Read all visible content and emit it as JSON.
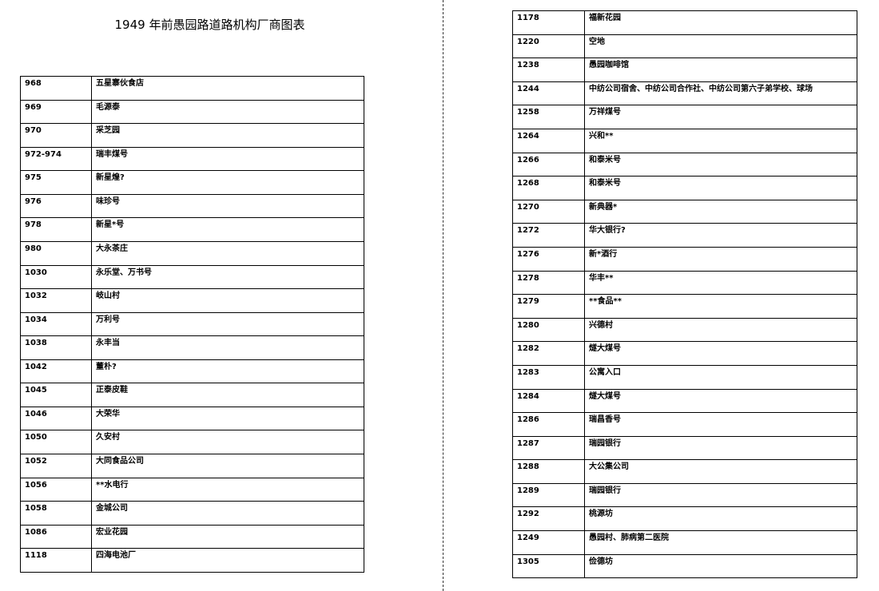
{
  "document": {
    "title": "1949 年前愚园路道路机构厂商图表"
  },
  "left_table": {
    "rows": [
      [
        "968",
        "五星寨伙食店"
      ],
      [
        "969",
        "毛源泰"
      ],
      [
        "970",
        "采芝园"
      ],
      [
        "972-974",
        "瑞丰煤号"
      ],
      [
        "975",
        "新星煌?"
      ],
      [
        "976",
        "味珍号"
      ],
      [
        "978",
        "新星*号"
      ],
      [
        "980",
        "大永茶庄"
      ],
      [
        "1030",
        "永乐堂、万书号"
      ],
      [
        "1032",
        "岐山村"
      ],
      [
        "1034",
        "万利号"
      ],
      [
        "1038",
        "永丰当"
      ],
      [
        "1042",
        "董朴?"
      ],
      [
        "1045",
        "正泰皮鞋"
      ],
      [
        "1046",
        "大荣华"
      ],
      [
        "1050",
        "久安村"
      ],
      [
        "1052",
        "大同食品公司"
      ],
      [
        "1056",
        "**水电行"
      ],
      [
        "1058",
        "金城公司"
      ],
      [
        "1086",
        "宏业花园"
      ],
      [
        "1118",
        "四海电池厂"
      ]
    ]
  },
  "right_table": {
    "rows": [
      [
        "1178",
        "福新花园"
      ],
      [
        "1220",
        "空地"
      ],
      [
        "1238",
        "愚园咖啡馆"
      ],
      [
        "1244",
        "中纺公司宿舍、中纺公司合作社、中纺公司第六子弟学校、球场"
      ],
      [
        "1258",
        "万祥煤号"
      ],
      [
        "1264",
        "兴和**"
      ],
      [
        "1266",
        "和泰米号"
      ],
      [
        "1268",
        "和泰米号"
      ],
      [
        "1270",
        "新典器*"
      ],
      [
        "1272",
        "华大银行?"
      ],
      [
        "1276",
        "新*酒行"
      ],
      [
        "1278",
        "华丰**"
      ],
      [
        "1279",
        "**食品**"
      ],
      [
        "1280",
        "兴德村"
      ],
      [
        "1282",
        "燧大煤号"
      ],
      [
        "1283",
        "公寓入口"
      ],
      [
        "1284",
        "燧大煤号"
      ],
      [
        "1286",
        "瑞昌香号"
      ],
      [
        "1287",
        "瑞园银行"
      ],
      [
        "1288",
        "大公集公司"
      ],
      [
        "1289",
        "瑞园银行"
      ],
      [
        "1292",
        "桃源坊"
      ],
      [
        "1249",
        "愚园村、肺病第二医院"
      ],
      [
        "1305",
        "俭德坊"
      ]
    ]
  }
}
